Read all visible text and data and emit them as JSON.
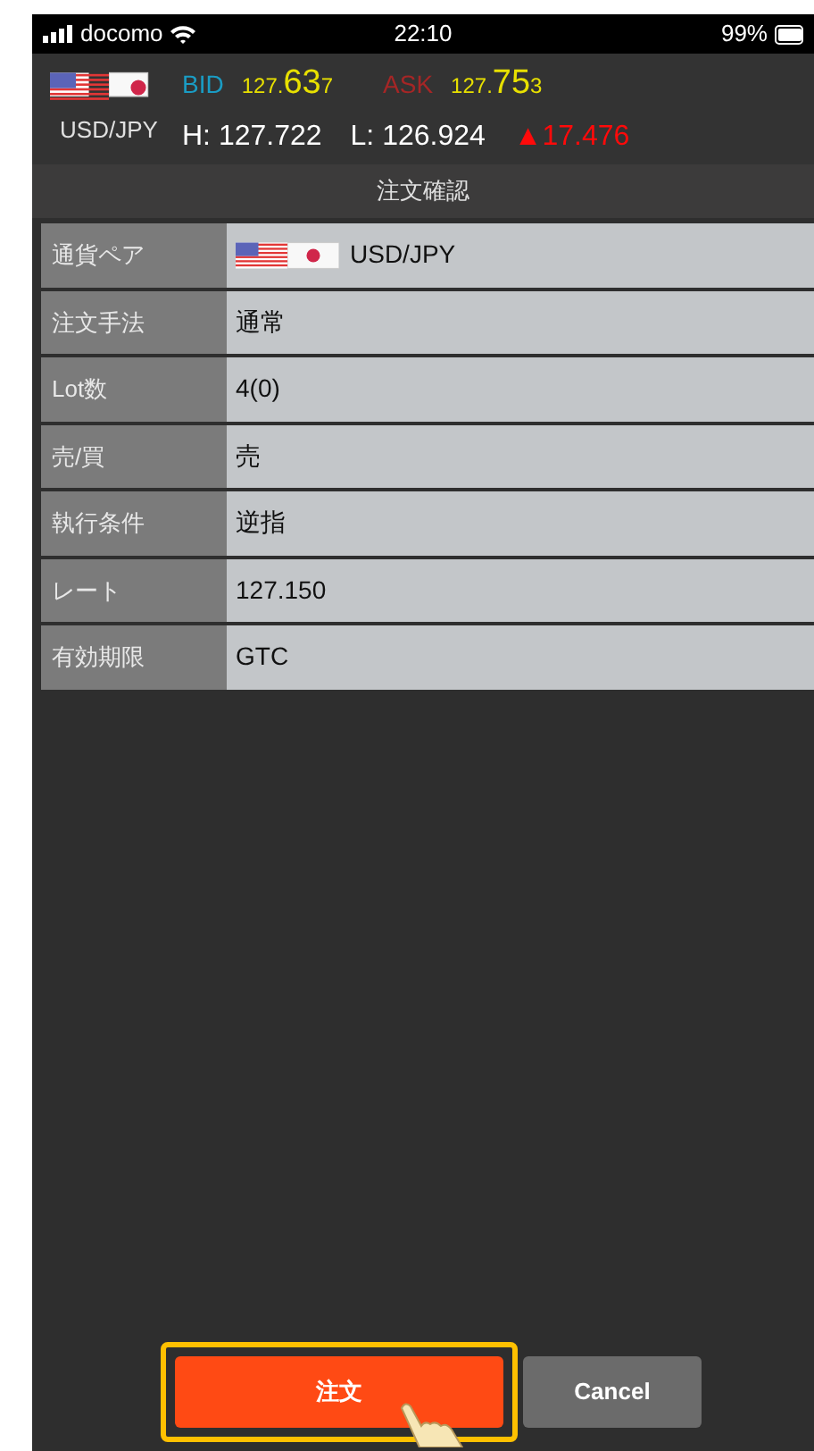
{
  "status_bar": {
    "carrier": "docomo",
    "time": "22:10",
    "battery": "99%"
  },
  "quote": {
    "pair": "USD/JPY",
    "bid": {
      "label": "BID",
      "head": "127.",
      "pips": "63",
      "tail": "7"
    },
    "ask": {
      "label": "ASK",
      "head": "127.",
      "pips": "75",
      "tail": "3"
    },
    "high": "H: 127.722",
    "low": "L: 126.924",
    "change": "▲17.476"
  },
  "title": "注文確認",
  "rows": [
    {
      "label": "通貨ペア",
      "value": "USD/JPY",
      "kind": "pair"
    },
    {
      "label": "注文手法",
      "value": "通常",
      "kind": "text"
    },
    {
      "label": "Lot数",
      "value": "4(0)",
      "kind": "text"
    },
    {
      "label": "売/買",
      "value": "売",
      "kind": "text"
    },
    {
      "label": "執行条件",
      "value": "逆指",
      "kind": "text"
    },
    {
      "label": "レート",
      "value": "127.150",
      "kind": "text"
    },
    {
      "label": "有効期限",
      "value": "GTC",
      "kind": "text"
    }
  ],
  "buttons": [
    {
      "label": "注文",
      "kind": "primary",
      "highlighted": true
    },
    {
      "label": "Cancel",
      "kind": "secondary",
      "highlighted": false
    }
  ]
}
